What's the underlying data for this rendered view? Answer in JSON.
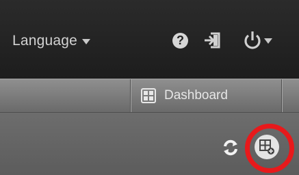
{
  "header": {
    "language_label": "Language",
    "icons": [
      "help-icon",
      "sign-in-icon",
      "power-icon"
    ]
  },
  "tabs": [
    {
      "label": "Dashboard",
      "icon": "dashboard-icon"
    }
  ],
  "toolbar": {
    "icons": [
      "refresh-icon",
      "add-widget-icon"
    ]
  },
  "colors": {
    "topbar": "#222222",
    "tabbar": "#7a7a7a",
    "toolbar": "#626262",
    "highlight_ring": "#e8191b"
  }
}
